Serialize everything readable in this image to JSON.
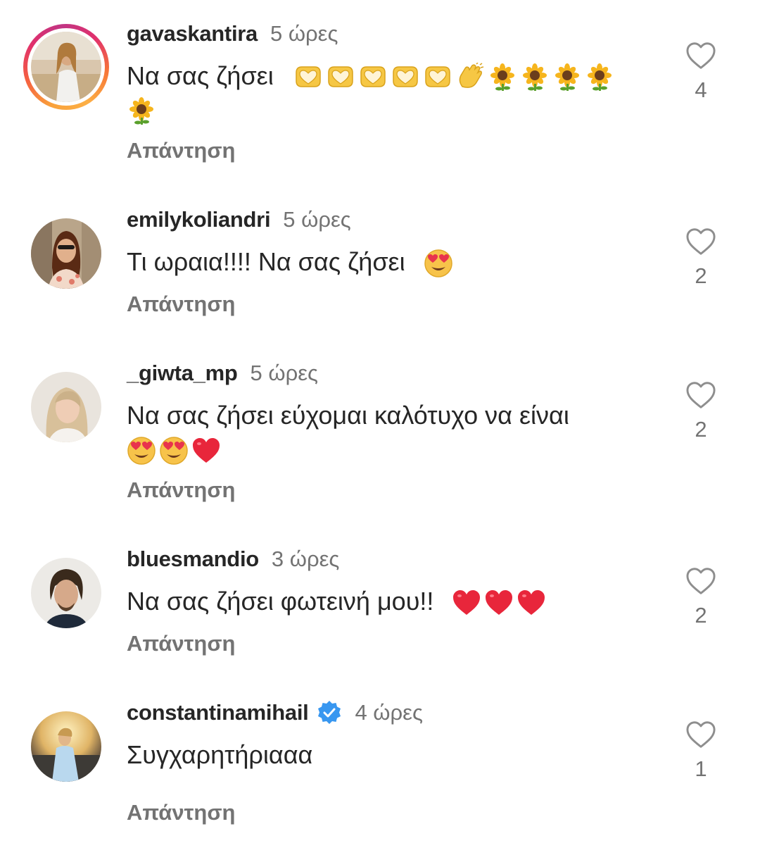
{
  "reply_label": "Απάντηση",
  "comments": [
    {
      "username": "gavaskantira",
      "time": "5 ώρες",
      "text": "Να σας ζήσει",
      "emojis": [
        "heart-hands",
        "heart-hands",
        "heart-hands",
        "heart-hands",
        "heart-hands",
        "clapping-hands",
        "sunflower",
        "sunflower",
        "sunflower",
        "sunflower",
        "sunflower"
      ],
      "likes": "4",
      "has_story": true,
      "verified": false
    },
    {
      "username": "emilykoliandri",
      "time": "5 ώρες",
      "text": "Τι ωραια!!!! Να σας ζήσει",
      "emojis": [
        "heart-eyes"
      ],
      "likes": "2",
      "has_story": false,
      "verified": false
    },
    {
      "username": "_giwta_mp",
      "time": "5 ώρες",
      "text": "Να σας ζήσει εύχομαι καλότυχο να είναι",
      "emojis": [
        "heart-eyes",
        "heart-eyes",
        "red-heart"
      ],
      "likes": "2",
      "has_story": false,
      "verified": false
    },
    {
      "username": "bluesmandio",
      "time": "3 ώρες",
      "text": "Να σας ζήσει φωτεινή μου!!",
      "emojis": [
        "red-heart",
        "red-heart",
        "red-heart"
      ],
      "likes": "2",
      "has_story": false,
      "verified": false
    },
    {
      "username": "constantinamihail",
      "time": "4 ώρες",
      "text": "Συγχαρητήριααα",
      "emojis": [],
      "likes": "1",
      "has_story": false,
      "verified": true
    }
  ],
  "colors": {
    "username": "#262626",
    "secondary": "#737373",
    "verified_badge": "#3897f0"
  }
}
